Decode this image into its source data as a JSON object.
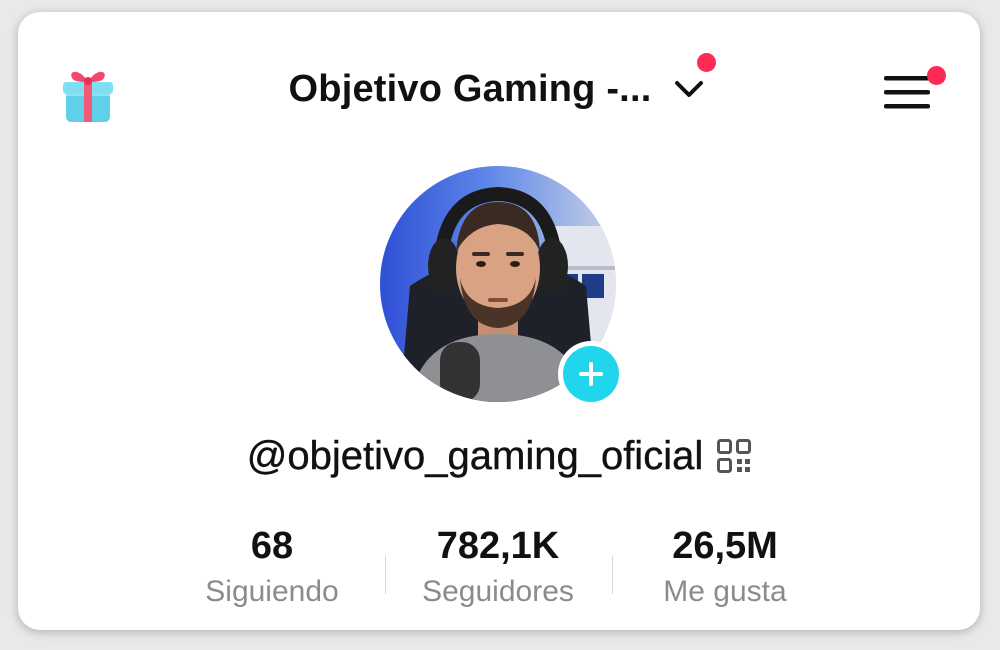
{
  "header": {
    "title": "Objetivo Gaming -...",
    "gift_icon": "gift-icon",
    "chevron_icon": "chevron-down-icon",
    "menu_icon": "hamburger-menu-icon",
    "notification_color": "#fe2c55"
  },
  "profile": {
    "avatar_icon": "avatar",
    "follow_icon": "plus-icon",
    "follow_color": "#20d5ec",
    "username": "@objetivo_gaming_oficial",
    "qr_icon": "qr-code-icon"
  },
  "stats": [
    {
      "value": "68",
      "label": "Siguiendo"
    },
    {
      "value": "782,1K",
      "label": "Seguidores"
    },
    {
      "value": "26,5M",
      "label": "Me gusta"
    }
  ]
}
